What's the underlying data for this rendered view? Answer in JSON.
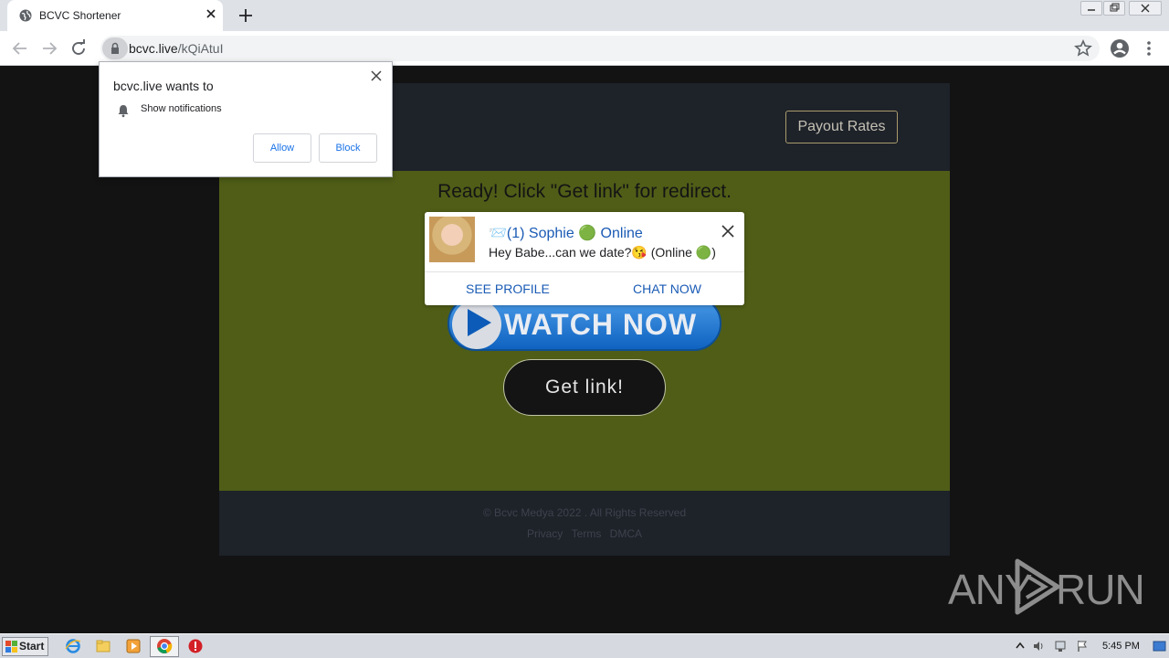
{
  "browser": {
    "tab_title": "BCVC Shortener",
    "url_host": "bcvc.live",
    "url_path": "/kQiAtuI"
  },
  "permission_popup": {
    "title": "bcvc.live wants to",
    "permission": "Show notifications",
    "allow_label": "Allow",
    "block_label": "Block"
  },
  "site": {
    "payout_label": "Payout Rates",
    "ready_text": "Ready! Click \"Get link\" for redirect.",
    "watch_now_label": "WATCH NOW",
    "get_link_label": "Get link!",
    "copyright": "© Bcvc Medya 2022 . All Rights Reserved",
    "footer_links": [
      "Privacy",
      "Terms",
      "DMCA"
    ]
  },
  "chat_notification": {
    "name": "📨(1) Sophie 🟢 Online",
    "message": "Hey Babe...can we date?😘 (Online 🟢)",
    "see_profile_label": "SEE PROFILE",
    "chat_now_label": "CHAT NOW"
  },
  "watermark": {
    "left": "ANY",
    "right": "RUN"
  },
  "taskbar": {
    "start_label": "Start",
    "clock": "5:45 PM"
  },
  "colors": {
    "page_bg": "#131313",
    "site_header_bg": "#1e2229",
    "site_main_bg": "#4f5d17",
    "link_blue": "#1a5bb5"
  }
}
